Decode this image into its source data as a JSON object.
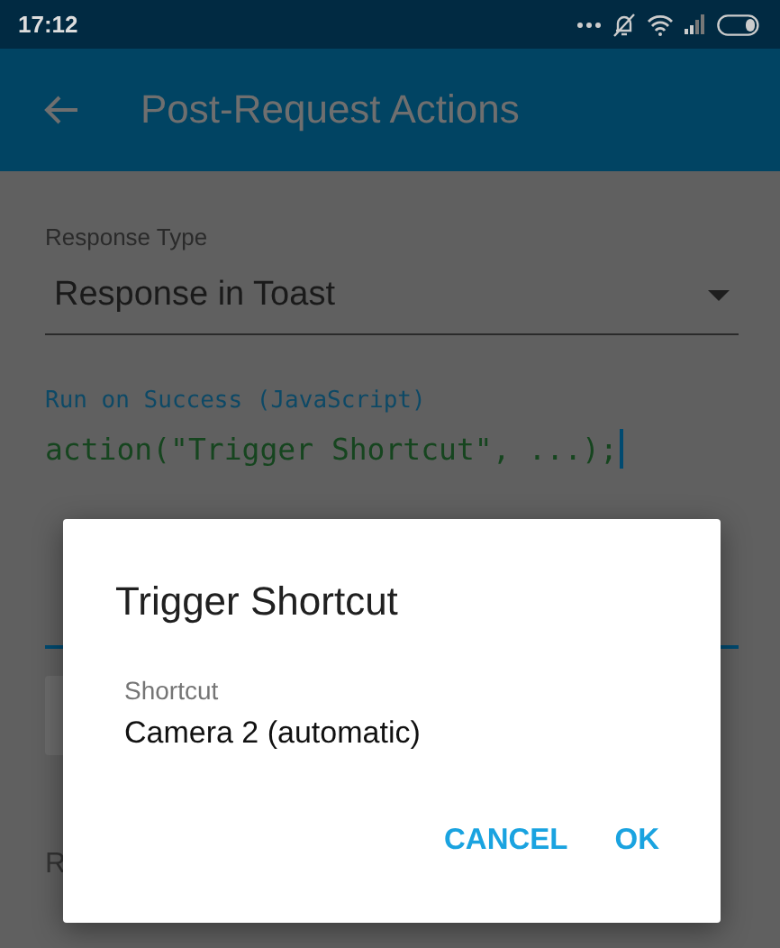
{
  "status_bar": {
    "time": "17:12"
  },
  "toolbar": {
    "title": "Post-Request Actions"
  },
  "form": {
    "response_type": {
      "label": "Response Type",
      "value": "Response in Toast"
    },
    "code_field": {
      "label": "Run on Success (JavaScript)",
      "value": "action(\"Trigger Shortcut\", ...);"
    },
    "partial_label": "R"
  },
  "dialog": {
    "title": "Trigger Shortcut",
    "field": {
      "label": "Shortcut",
      "value": "Camera 2 (automatic)"
    },
    "buttons": [
      {
        "label": "CANCEL"
      },
      {
        "label": "OK"
      }
    ]
  }
}
